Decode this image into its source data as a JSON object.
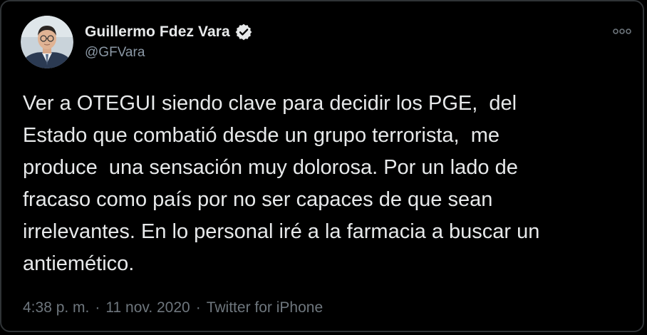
{
  "author": {
    "display_name": "Guillermo Fdez Vara",
    "handle": "@GFVara",
    "verified": true,
    "verified_icon": "verified-badge-icon",
    "avatar_icon": "profile-photo"
  },
  "tweet": {
    "text": "Ver a OTEGUI siendo clave para decidir los PGE,  del\nEstado que combatió desde un grupo terrorista,  me\nproduce  una sensación muy dolorosa. Por un lado de\nfracaso como país por no ser capaces de que sean\nirrelevantes. En lo personal iré a la farmacia a buscar un\nantiemético."
  },
  "meta": {
    "time": "4:38 p. m.",
    "separator_1": "·",
    "date": "11 nov. 2020",
    "separator_2": "·",
    "source": "Twitter for iPhone"
  },
  "more_icon": "more-options-icon",
  "colors": {
    "background": "#000000",
    "text": "#e7e9ea",
    "secondary_text": "#6e767d",
    "verified": "#e7e9ea"
  }
}
